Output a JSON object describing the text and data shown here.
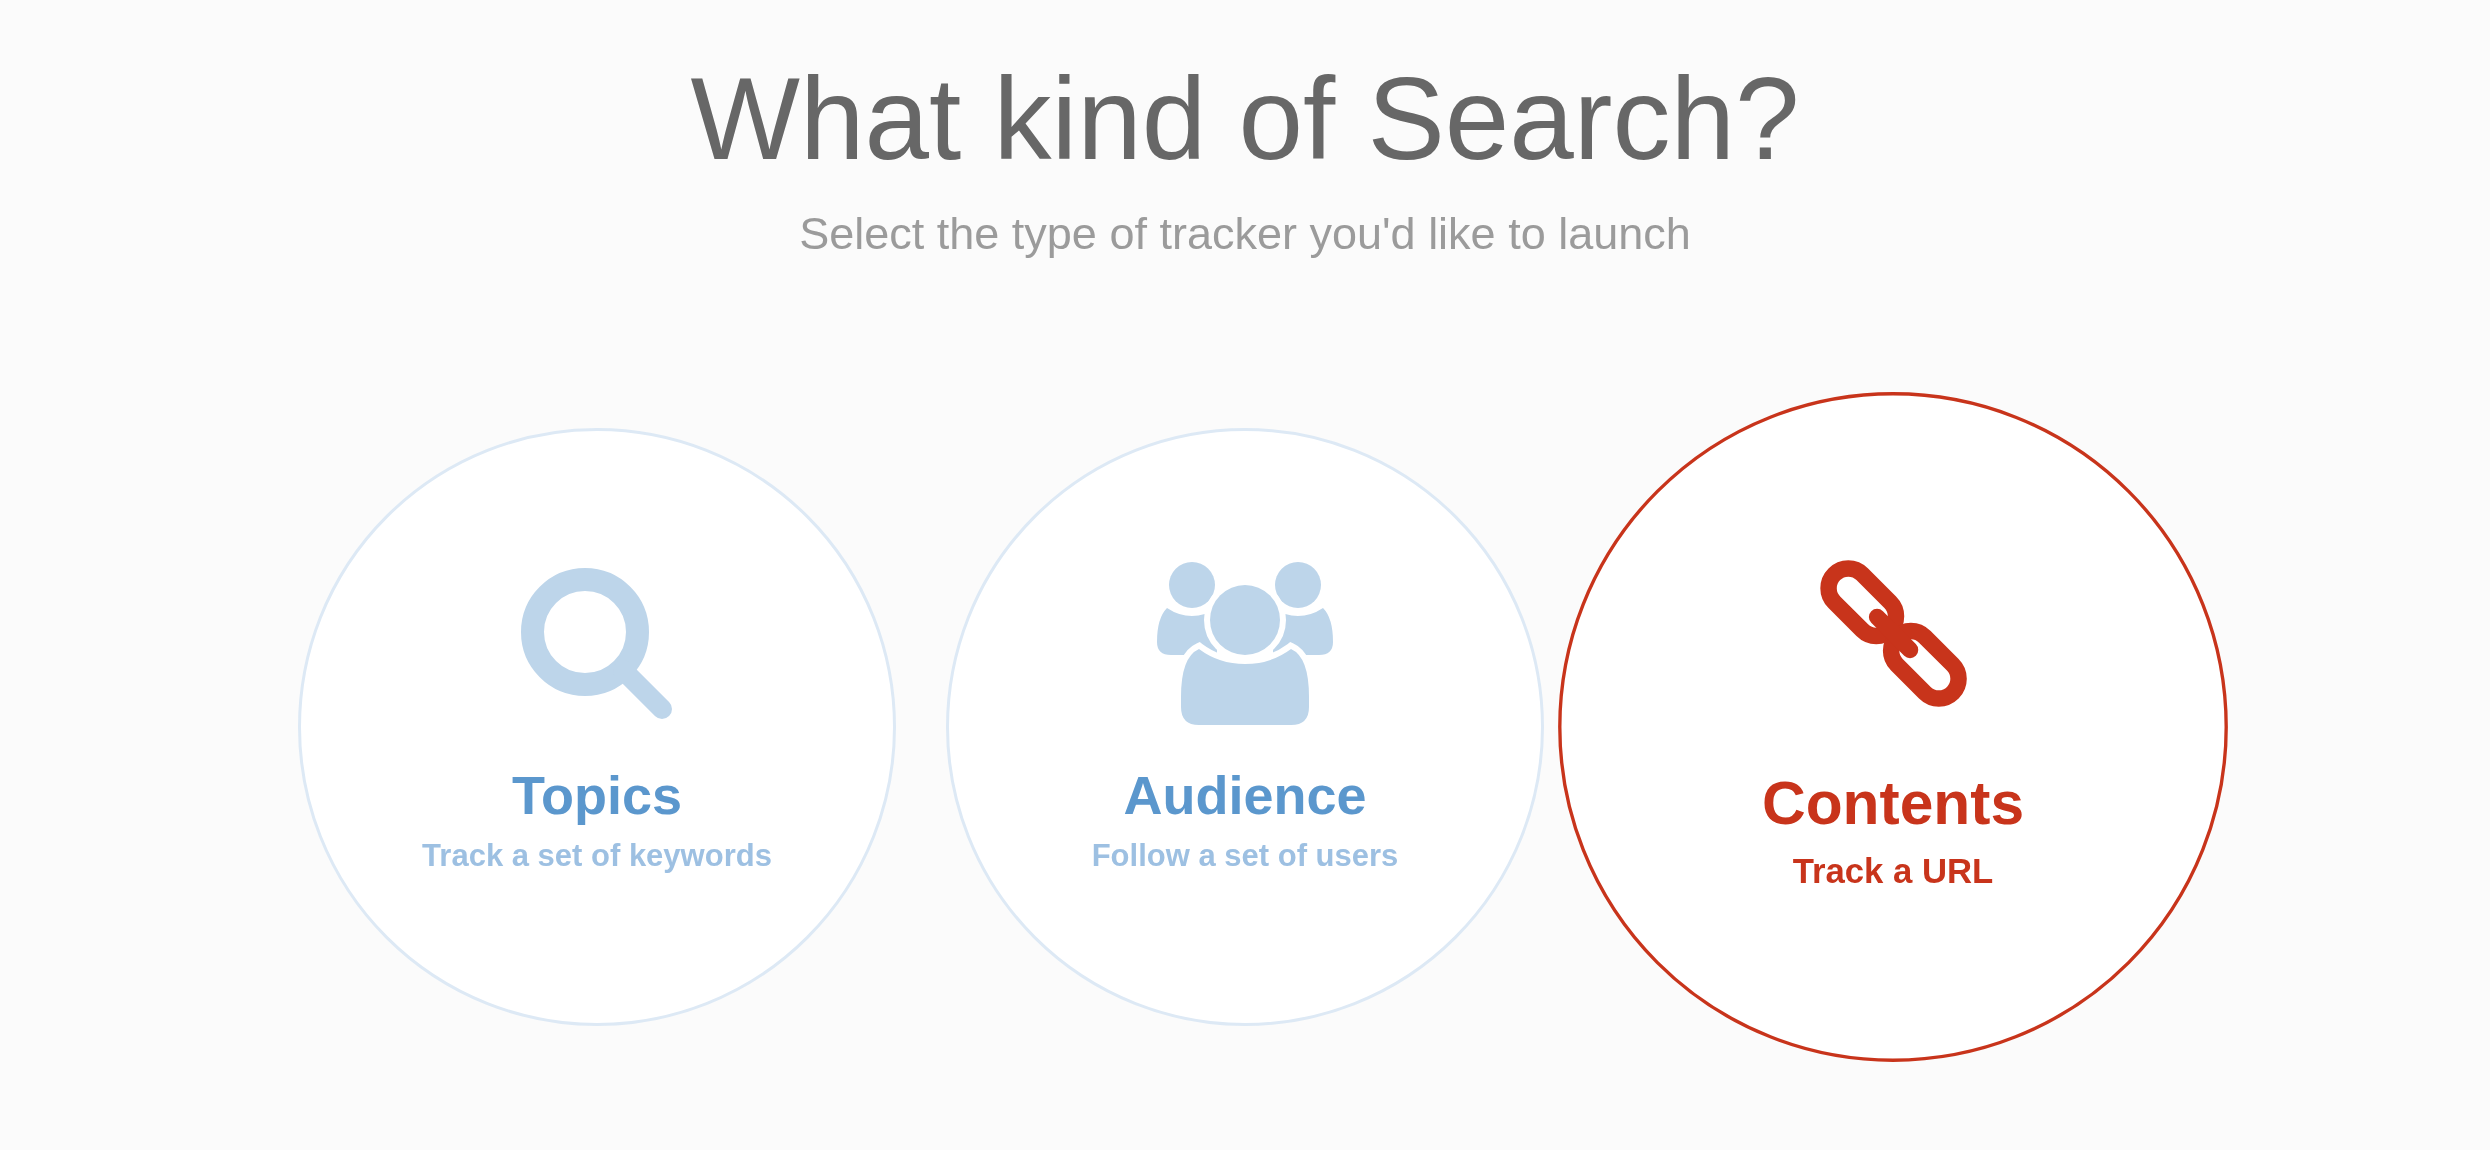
{
  "header": {
    "title": "What kind of Search?",
    "subtitle": "Select the type of tracker you'd like to launch"
  },
  "options": [
    {
      "kind": "search",
      "title": "Topics",
      "description": "Track a set of keywords",
      "selected": false
    },
    {
      "kind": "people",
      "title": "Audience",
      "description": "Follow a set of users",
      "selected": false
    },
    {
      "kind": "link",
      "title": "Contents",
      "description": "Track a URL",
      "selected": true
    }
  ]
}
